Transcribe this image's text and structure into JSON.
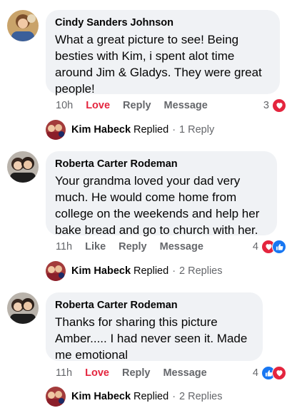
{
  "comments": [
    {
      "author": "Cindy Sanders Johnson",
      "text": "What a great picture to see! Being besties with Kim, i spent alot time around Jim & Gladys. They were great people!",
      "time": "10h",
      "love_label": "Love",
      "reply_label": "Reply",
      "message_label": "Message",
      "reaction_count": "3",
      "reactions": [
        "heart"
      ],
      "replies": {
        "name": "Kim Habeck",
        "verb": "Replied",
        "separator": "·",
        "count": "1 Reply"
      }
    },
    {
      "author": "Roberta Carter Rodeman",
      "text": "Your grandma loved your dad very much. He would come home from college on the weekends and help her bake bread and go to church with her.",
      "time": "11h",
      "like_label": "Like",
      "reply_label": "Reply",
      "message_label": "Message",
      "reaction_count": "4",
      "reactions": [
        "heart",
        "like"
      ],
      "replies": {
        "name": "Kim Habeck",
        "verb": "Replied",
        "separator": "·",
        "count": "2 Replies"
      }
    },
    {
      "author": "Roberta Carter Rodeman",
      "text": "Thanks for sharing this picture Amber..... I had never seen it. Made me emotional",
      "time": "11h",
      "love_label": "Love",
      "reply_label": "Reply",
      "message_label": "Message",
      "reaction_count": "4",
      "reactions": [
        "like",
        "heart"
      ],
      "replies": {
        "name": "Kim Habeck",
        "verb": "Replied",
        "separator": "·",
        "count": "2 Replies"
      }
    }
  ],
  "colors": {
    "bubble": "#f0f2f5",
    "love": "#e4253e",
    "like": "#1877f2",
    "secondary_text": "#65676b"
  },
  "icons": [
    "heart-reaction-icon",
    "like-reaction-icon",
    "avatar-cindy",
    "avatar-roberta",
    "avatar-kim"
  ]
}
